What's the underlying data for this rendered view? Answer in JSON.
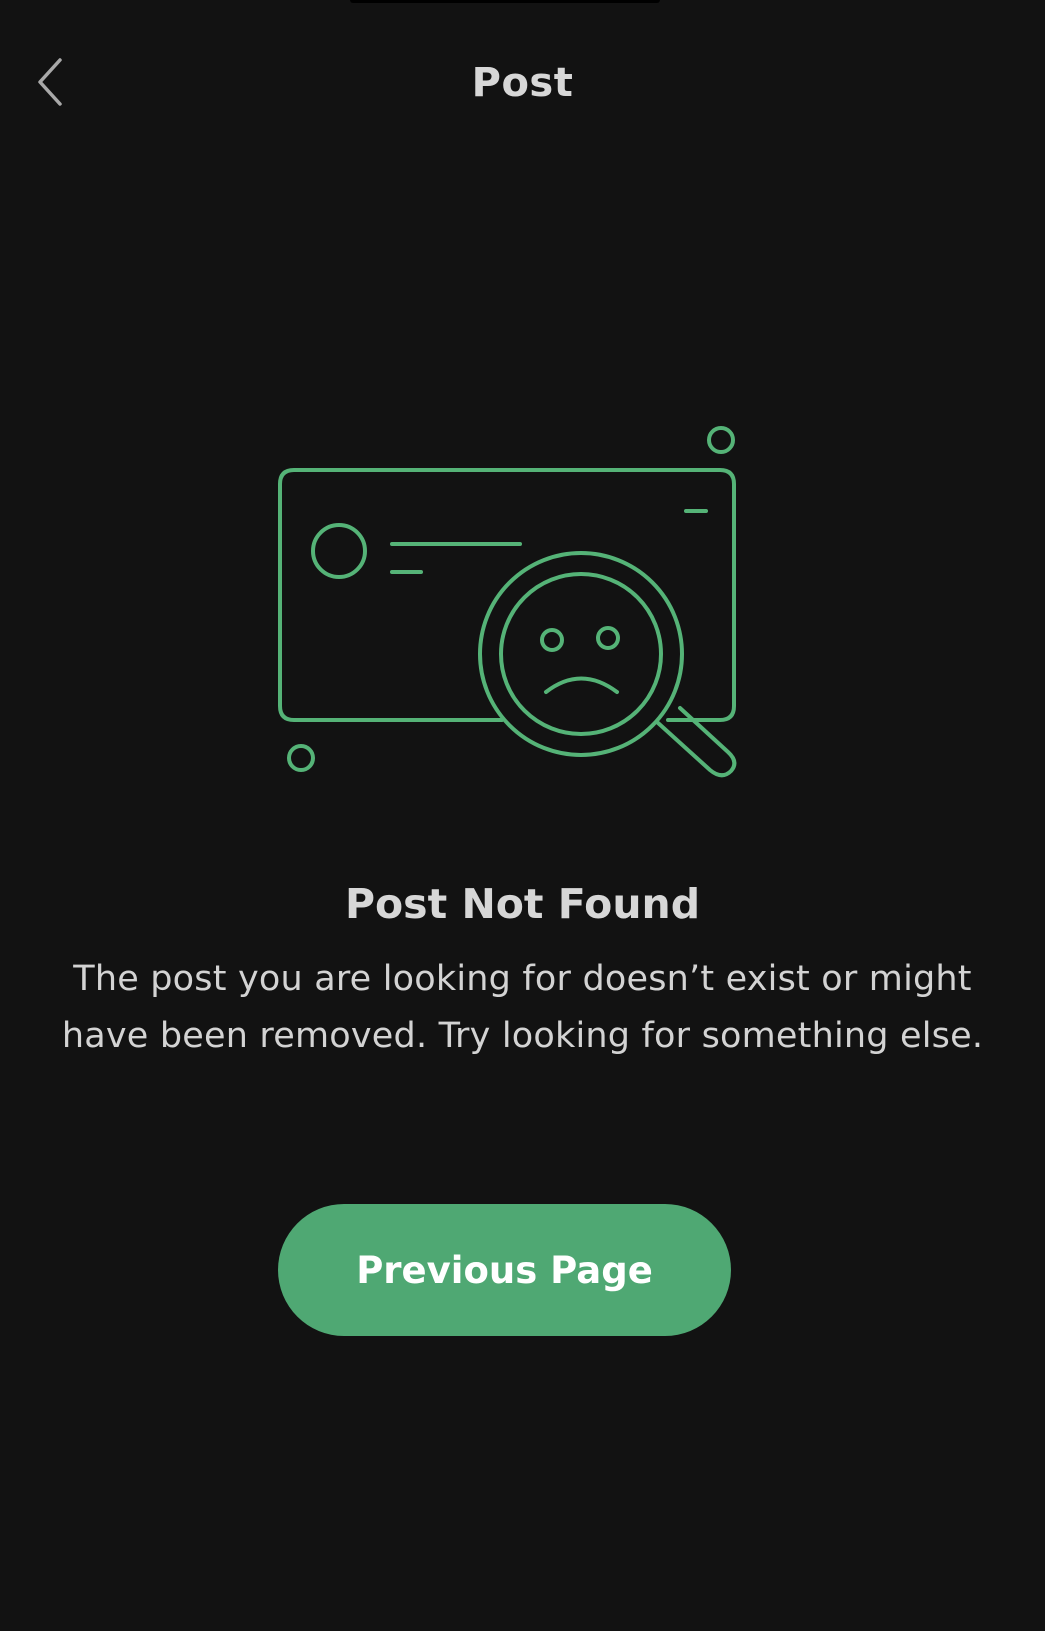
{
  "header": {
    "title": "Post",
    "back_icon": "chevron-left-icon"
  },
  "illustration": {
    "icon": "post-not-found-magnifier-sad-face-icon",
    "stroke_color": "#55b377"
  },
  "empty_state": {
    "title": "Post Not Found",
    "message": "The post you are looking for doesn’t exist or might have been removed. Try looking for something else."
  },
  "actions": {
    "previous_page_label": "Previous Page"
  },
  "colors": {
    "background": "#121212",
    "accent": "#4fa873",
    "text": "#d6d6d6",
    "button_text": "#ffffff"
  }
}
